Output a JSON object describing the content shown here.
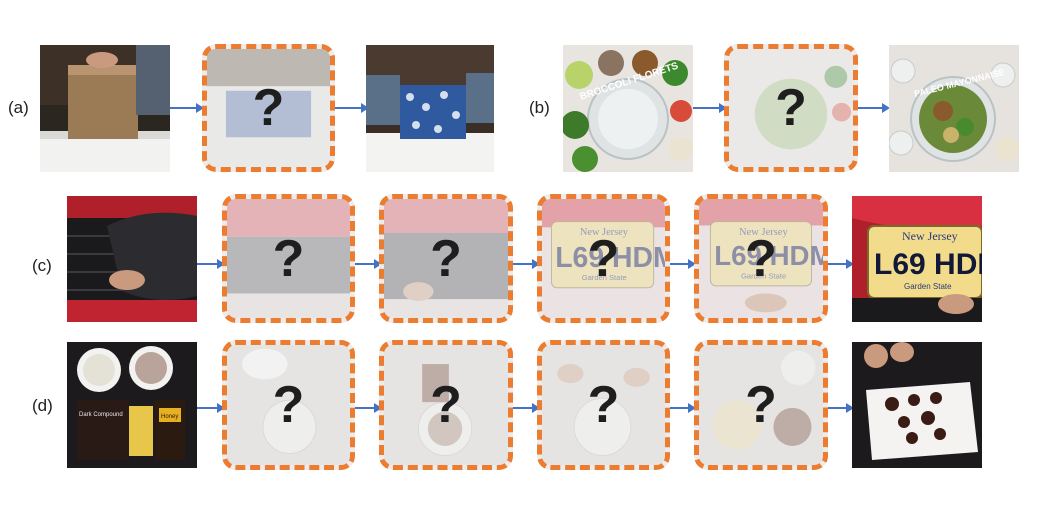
{
  "rows": [
    {
      "label": "(a)",
      "hidden_marker": "?"
    },
    {
      "label": "(b)",
      "hidden_marker": "?",
      "overlay_start": "BROCCOLI FLORETS",
      "overlay_end": "PALEO MAYONNAISE"
    },
    {
      "label": "(c)",
      "hidden_marker": "?",
      "plate_state": "New Jersey",
      "plate_number": "L69 HDM",
      "plate_slogan": "Garden State"
    },
    {
      "label": "(d)",
      "hidden_marker": "?",
      "package_text_1": "Dark Compound",
      "package_text_2": "Honey"
    }
  ],
  "colors": {
    "dashed_border": "#ec7c30",
    "arrow": "#4472c4"
  }
}
